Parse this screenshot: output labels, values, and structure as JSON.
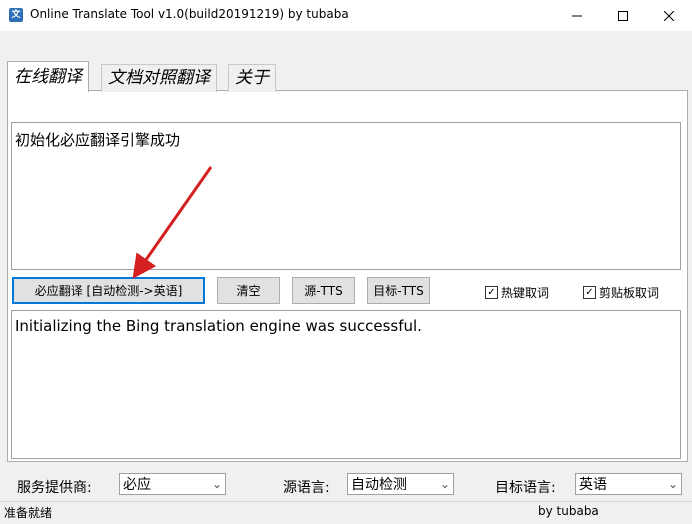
{
  "window": {
    "title": "Online Translate Tool v1.0(build20191219) by tubaba",
    "icon": "translate-app-icon"
  },
  "tabs": [
    {
      "label": "在线翻译",
      "active": true
    },
    {
      "label": "文档对照翻译",
      "active": false
    },
    {
      "label": "关于",
      "active": false
    }
  ],
  "source": {
    "text": "初始化必应翻译引擎成功"
  },
  "toolbar": {
    "translate_label": "必应翻译 [自动检测->英语]",
    "clear_label": "清空",
    "src_tts_label": "源-TTS",
    "tgt_tts_label": "目标-TTS",
    "hotkey_label": "热键取词",
    "hotkey_checked": true,
    "clipboard_label": "剪贴板取词",
    "clipboard_checked": true
  },
  "result": {
    "text": "Initializing the Bing translation engine was successful."
  },
  "bottom": {
    "provider_label": "服务提供商:",
    "provider_value": "必应",
    "src_lang_label": "源语言:",
    "src_lang_value": "自动检测",
    "tgt_lang_label": "目标语言:",
    "tgt_lang_value": "英语"
  },
  "status": {
    "text": "准备就绪",
    "author": "by tubaba"
  },
  "colors": {
    "accent": "#0078d7",
    "arrow": "#d42020"
  }
}
